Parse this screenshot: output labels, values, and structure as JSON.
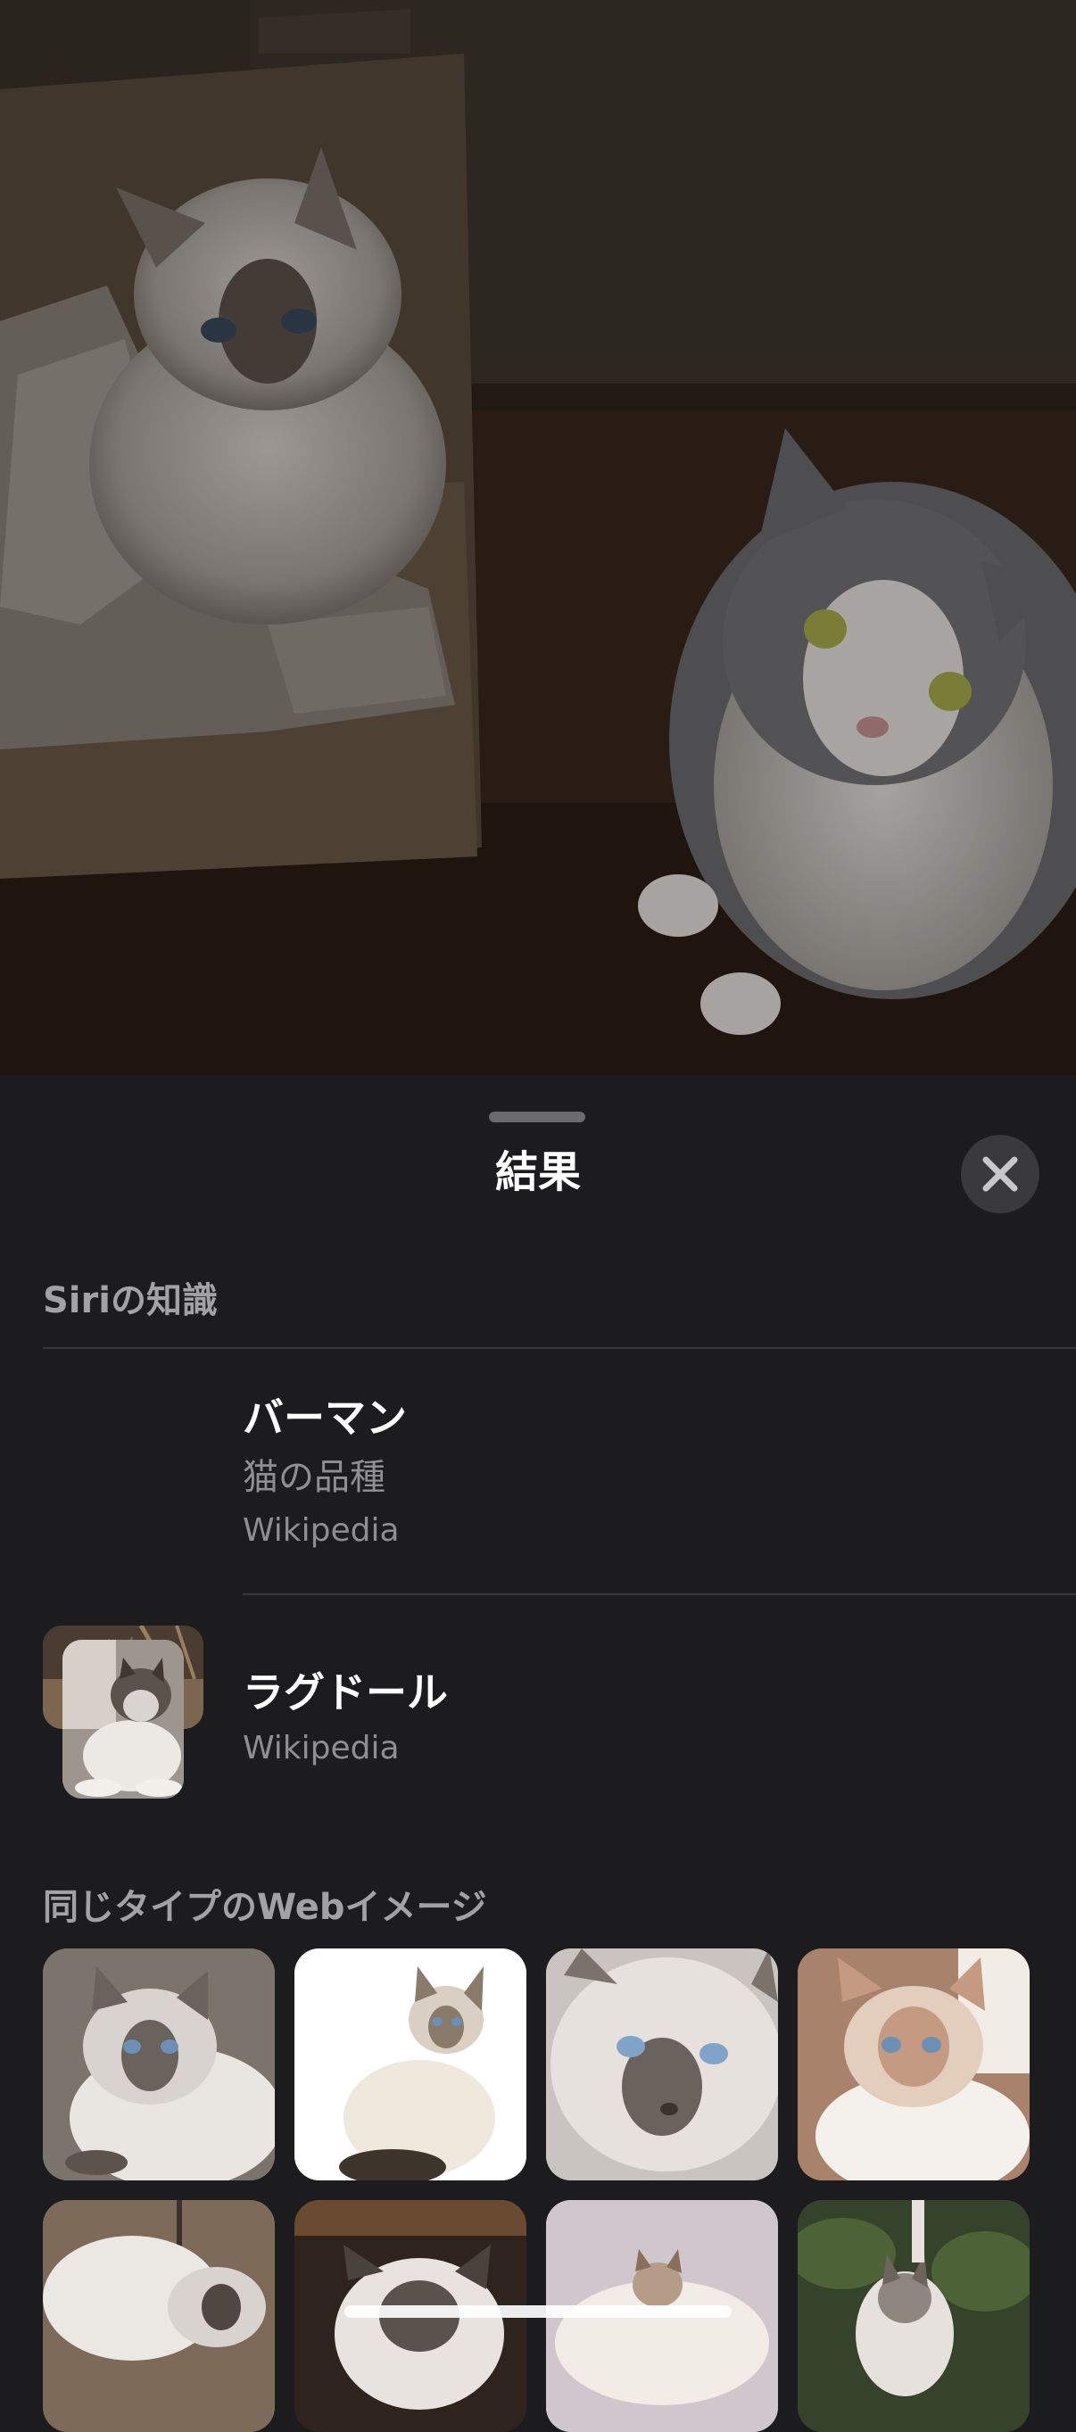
{
  "sheet": {
    "title": "結果",
    "close_icon": "close-icon"
  },
  "siri_knowledge": {
    "header": "Siriの知識",
    "results": [
      {
        "title": "バーマン",
        "subtitle": "猫の品種",
        "source": "Wikipedia"
      },
      {
        "title": "ラグドール",
        "source": "Wikipedia"
      }
    ]
  },
  "web_images": {
    "header": "同じタイプのWebイメージ",
    "image_count_visible": 8
  },
  "colors": {
    "sheet_background": "#1c1c1e",
    "primary_text": "#ffffff",
    "secondary_text": "#8e8e93",
    "section_header": "#a1a1a6"
  }
}
